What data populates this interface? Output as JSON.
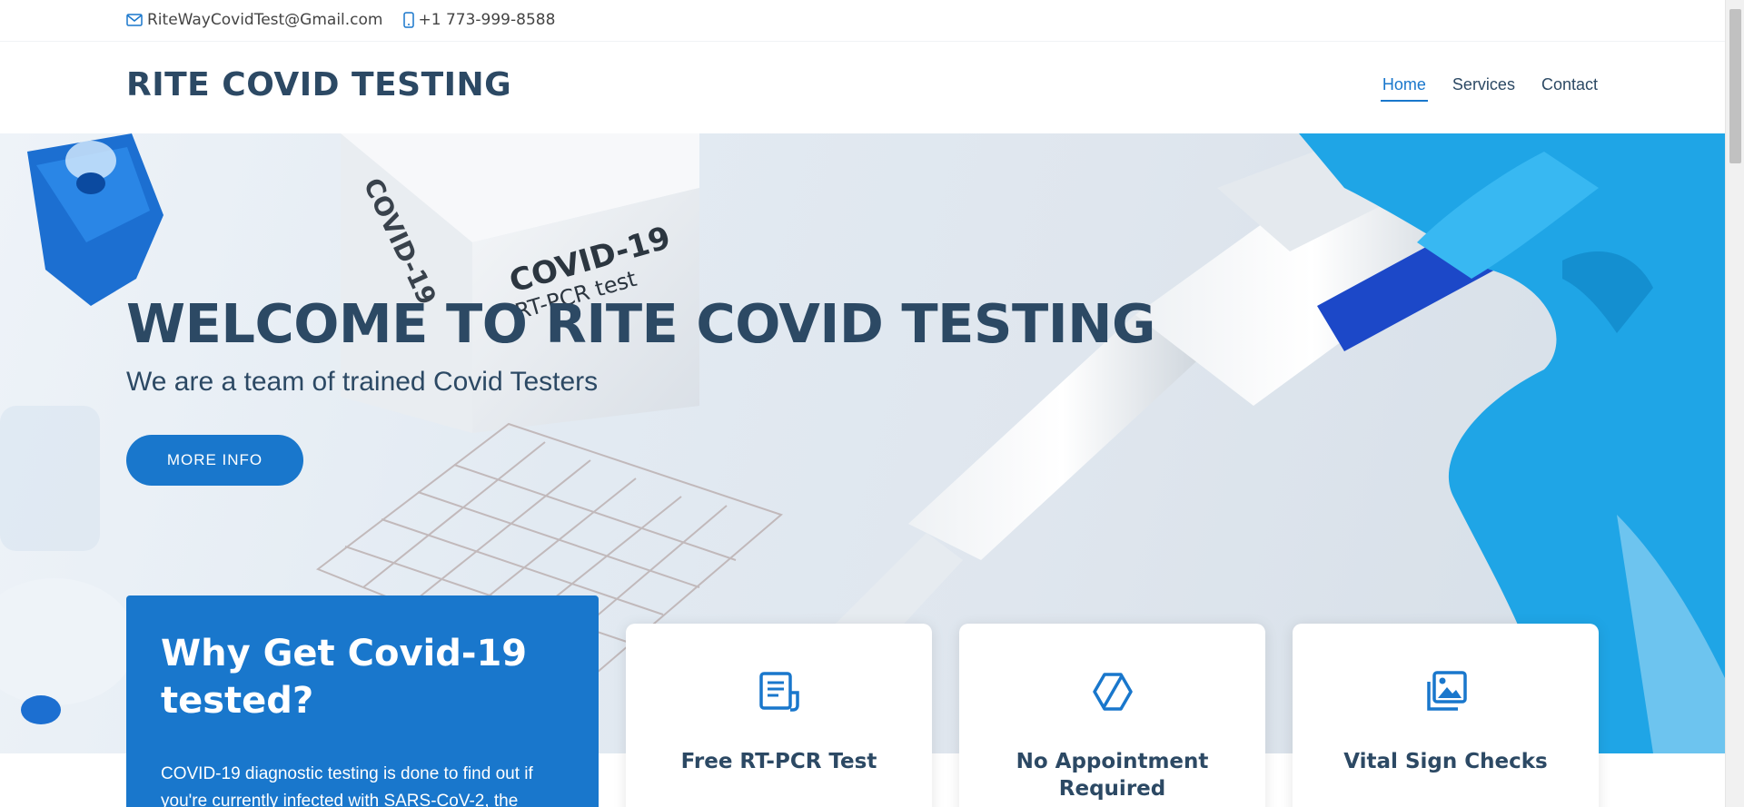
{
  "topbar": {
    "email": "RiteWayCovidTest@Gmail.com",
    "phone": "+1 773-999-8588"
  },
  "header": {
    "logo": "RITE COVID TESTING",
    "nav": [
      {
        "label": "Home",
        "active": true
      },
      {
        "label": "Services",
        "active": false
      },
      {
        "label": "Contact",
        "active": false
      }
    ]
  },
  "hero": {
    "title": "WELCOME TO RITE COVID TESTING",
    "subtitle": "We are a team of trained Covid Testers",
    "button": "MORE INFO",
    "box_text_1": "COVID-19",
    "box_text_2": "RT-PCR test"
  },
  "why": {
    "title": "Why Get Covid-19 tested?",
    "text": "COVID-19 diagnostic testing is done to find out if you're currently infected with SARS-CoV-2, the"
  },
  "cards": [
    {
      "title": "Free RT-PCR Test",
      "icon": "receipt-icon"
    },
    {
      "title": "No Appointment Required",
      "icon": "cube-icon"
    },
    {
      "title": "Vital Sign Checks",
      "icon": "images-icon"
    }
  ],
  "colors": {
    "accent": "#1977cc",
    "heading": "#2c4964",
    "glove": "#1fa5e6"
  }
}
